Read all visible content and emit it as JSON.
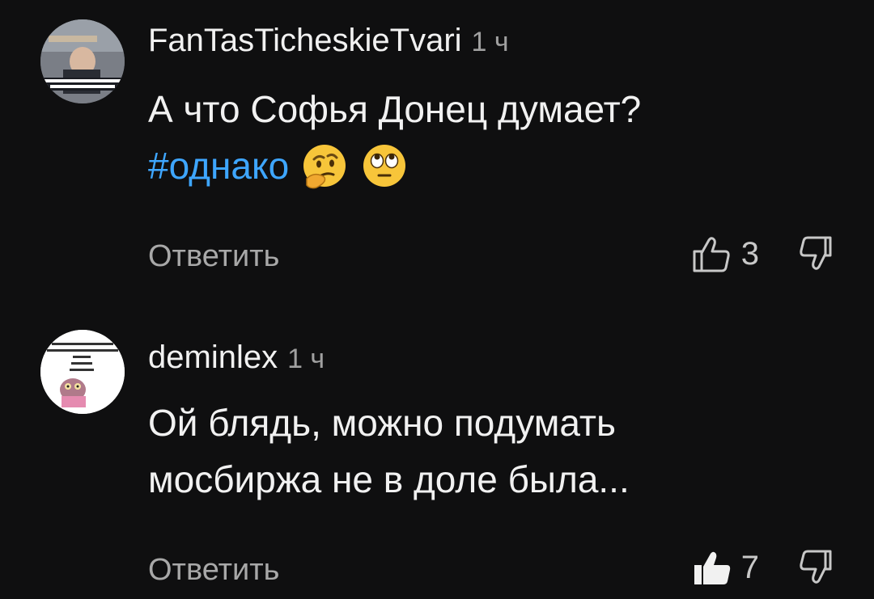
{
  "comments": [
    {
      "author": "FanTasTicheskieTvari",
      "time": "1 ч",
      "text_line1": "А что Софья Донец думает?",
      "hashtag": "#однако",
      "emojis": [
        "thinking-face",
        "rolling-eyes"
      ],
      "reply_label": "Ответить",
      "likes": "3",
      "liked": false
    },
    {
      "author": "deminlex",
      "time": "1 ч",
      "text_line1": "Ой блядь, можно подумать",
      "text_line2": "мосбиржа не в доле была...",
      "reply_label": "Ответить",
      "likes": "7",
      "liked": true
    }
  ],
  "colors": {
    "background": "#0f0f10",
    "text": "#f1f1f1",
    "hashtag": "#3ea6ff",
    "muted": "#a8a8a8"
  }
}
